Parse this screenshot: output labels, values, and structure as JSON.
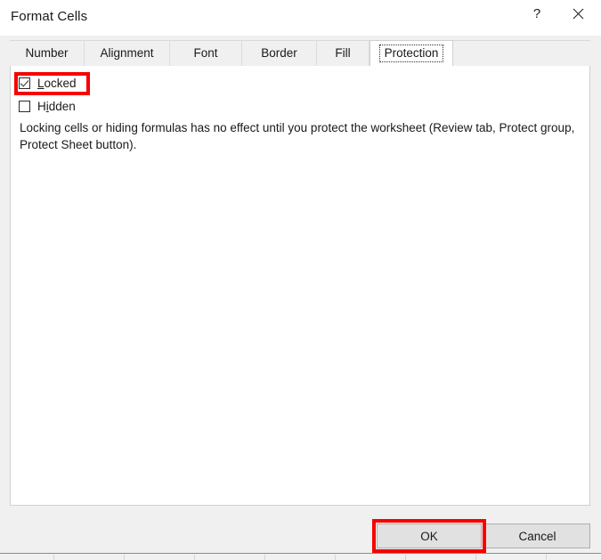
{
  "dialog": {
    "title": "Format Cells",
    "help_label": "?",
    "close_label": "✕"
  },
  "tabs": [
    {
      "label": "Number",
      "selected": false
    },
    {
      "label": "Alignment",
      "selected": false
    },
    {
      "label": "Font",
      "selected": false
    },
    {
      "label": "Border",
      "selected": false
    },
    {
      "label": "Fill",
      "selected": false
    },
    {
      "label": "Protection",
      "selected": true
    }
  ],
  "protection": {
    "checkboxes": [
      {
        "label_before": "",
        "accel": "L",
        "label_after": "ocked",
        "checked": true
      },
      {
        "label_before": "H",
        "accel": "i",
        "label_after": "dden",
        "checked": false
      }
    ],
    "description": "Locking cells or hiding formulas has no effect until you protect the worksheet (Review tab, Protect group, Protect Sheet button)."
  },
  "buttons": {
    "ok": "OK",
    "cancel": "Cancel"
  },
  "annotations": {
    "color": "#f70000",
    "targets": [
      "locked-checkbox",
      "ok-button"
    ]
  }
}
